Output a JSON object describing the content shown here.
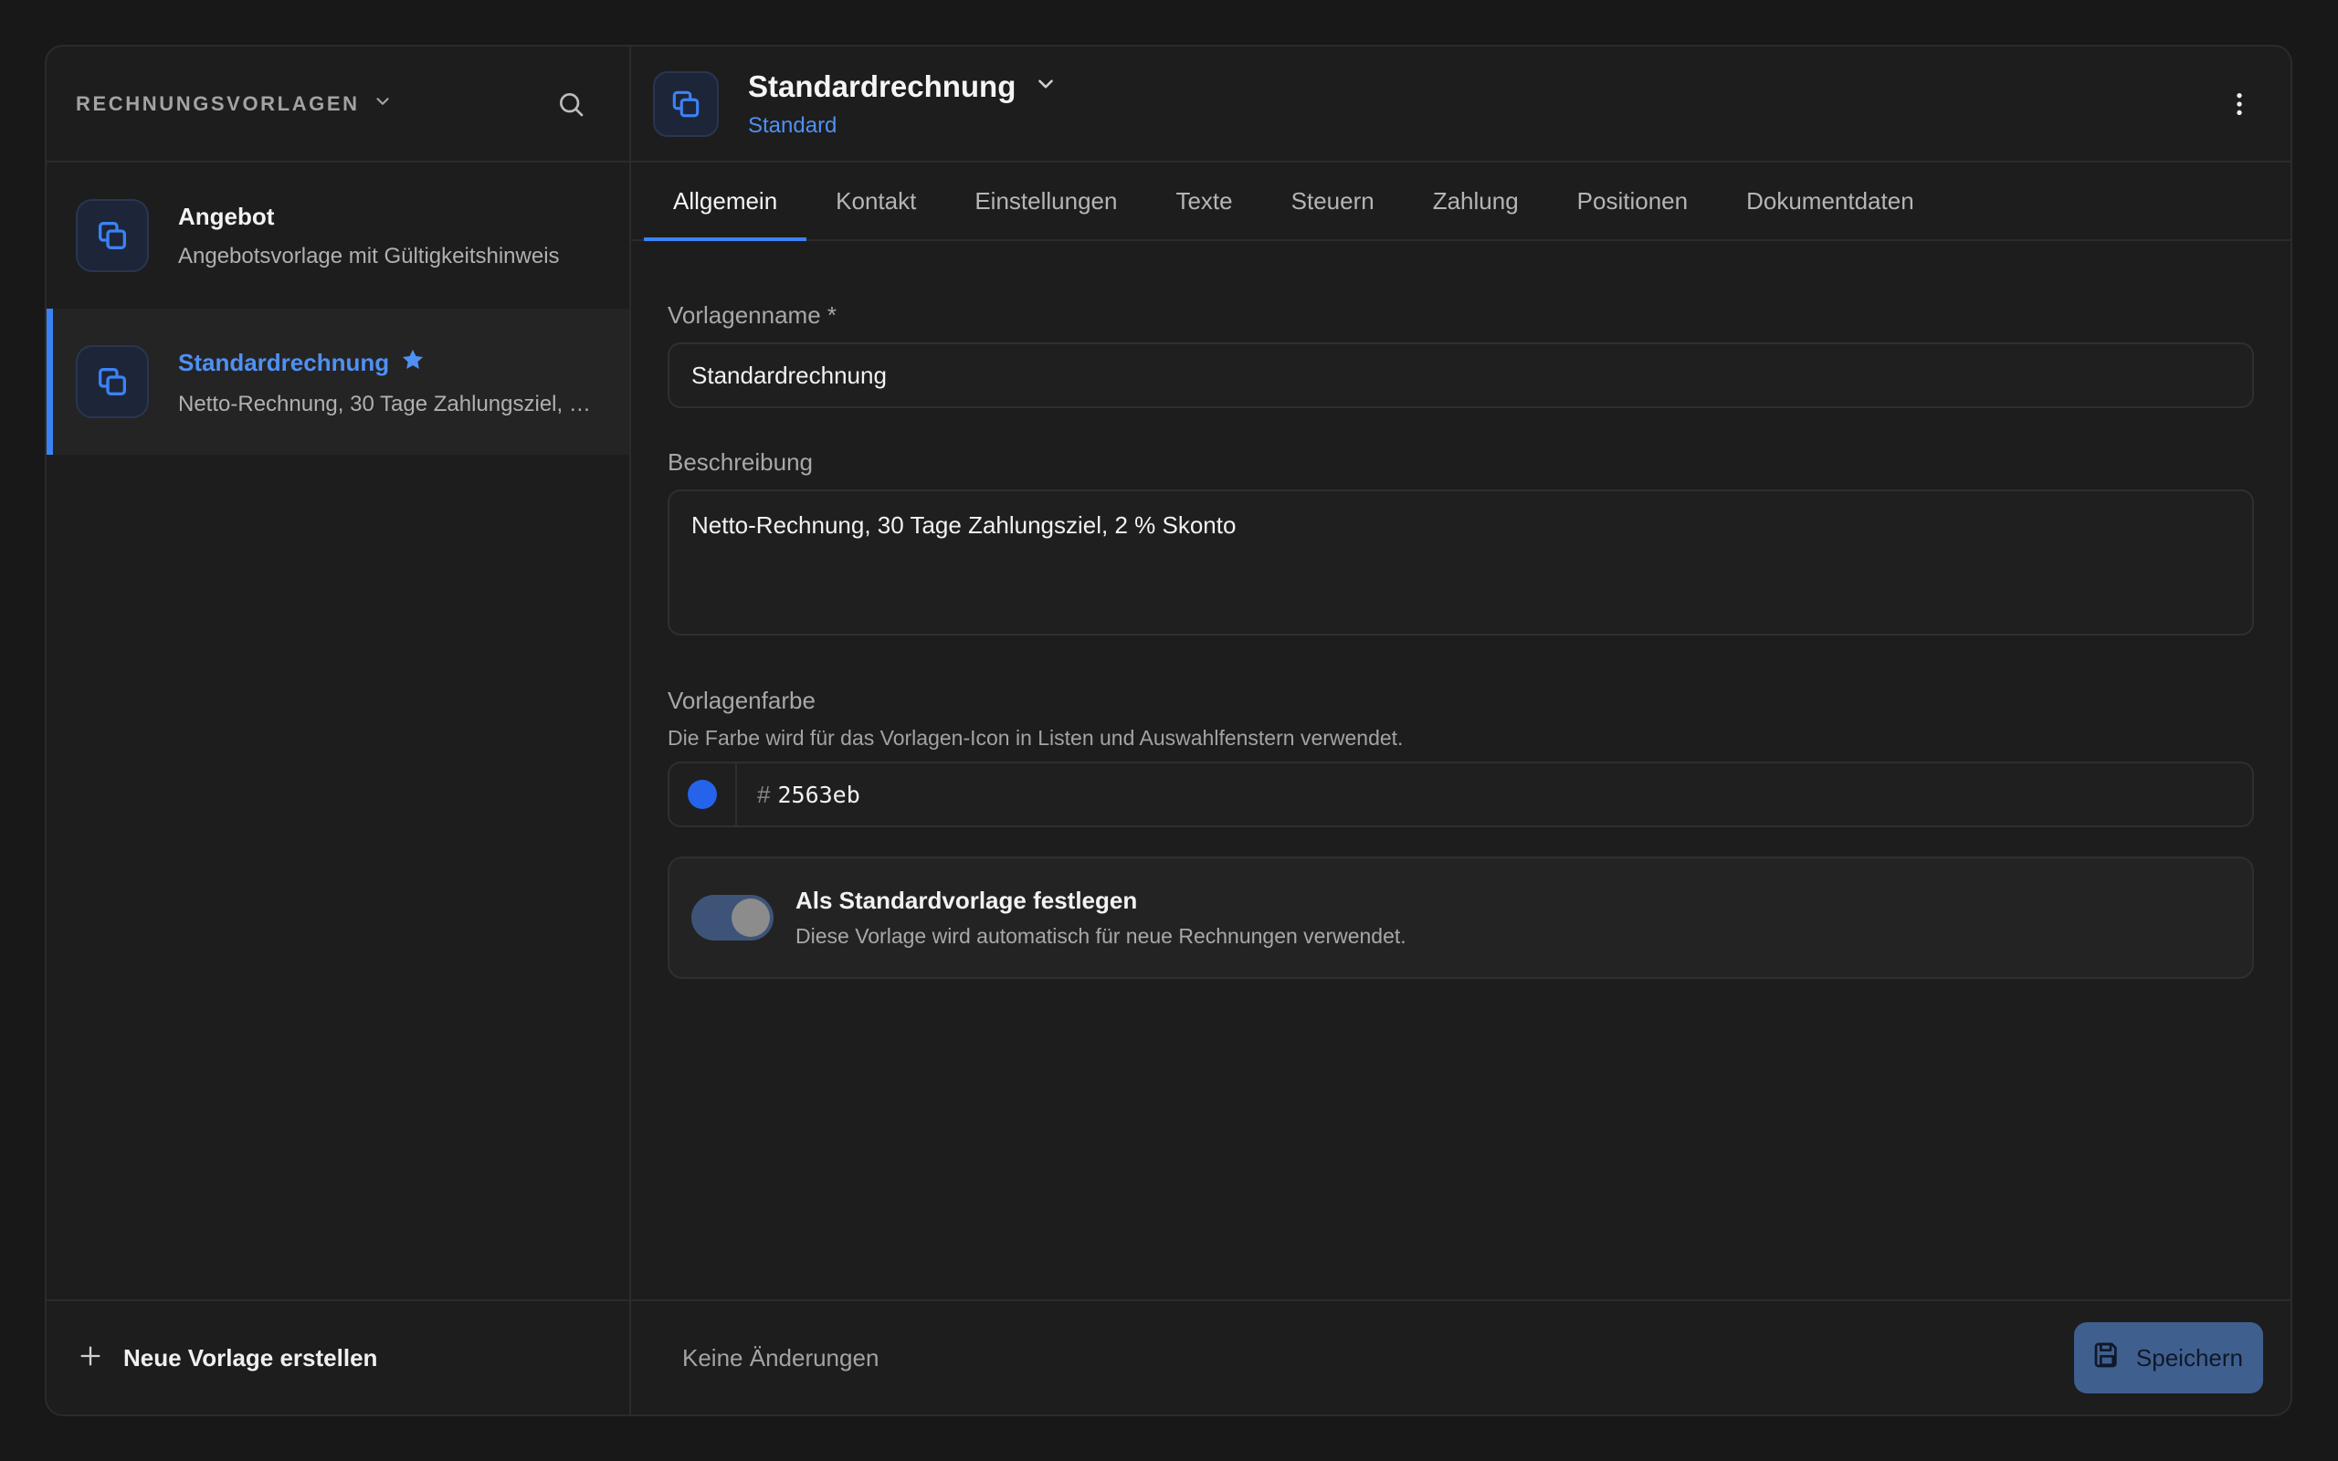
{
  "sidebar": {
    "title": "RECHNUNGSVORLAGEN",
    "items": [
      {
        "name": "Angebot",
        "description": "Angebotsvorlage mit Gültigkeitshinweis",
        "active": false,
        "favorite": false
      },
      {
        "name": "Standardrechnung",
        "description": "Netto-Rechnung, 30 Tage Zahlungsziel, 2 % Skonto",
        "active": true,
        "favorite": true
      }
    ],
    "new_label": "Neue Vorlage erstellen"
  },
  "header": {
    "title": "Standardrechnung",
    "subtitle": "Standard"
  },
  "tabs": [
    "Allgemein",
    "Kontakt",
    "Einstellungen",
    "Texte",
    "Steuern",
    "Zahlung",
    "Positionen",
    "Dokumentdaten"
  ],
  "active_tab": "Allgemein",
  "form": {
    "name_label": "Vorlagenname *",
    "name_value": "Standardrechnung",
    "description_label": "Beschreibung",
    "description_value": "Netto-Rechnung, 30 Tage Zahlungsziel, 2 % Skonto",
    "color_label": "Vorlagenfarbe",
    "color_help": "Die Farbe wird für das Vorlagen-Icon in Listen und Auswahlfenstern verwendet.",
    "color_hash": "#",
    "color_value": "2563eb",
    "default_title": "Als Standardvorlage festlegen",
    "default_desc": "Diese Vorlage wird automatisch für neue Rechnungen verwendet.",
    "default_on": true
  },
  "footer": {
    "status": "Keine Änderungen",
    "save_label": "Speichern"
  },
  "colors": {
    "accent": "#3b82f6",
    "accent_text": "#4f90f5",
    "swatch": "#2563eb"
  }
}
